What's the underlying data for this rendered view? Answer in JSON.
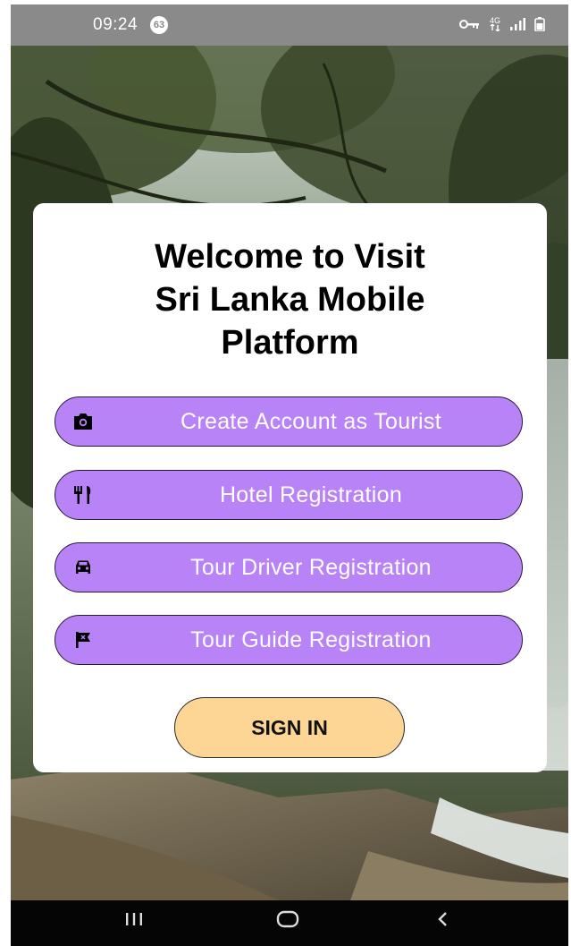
{
  "status_bar": {
    "time": "09:24",
    "notification_count": "63",
    "network_label": "4G",
    "icons": [
      "vpn-key-icon",
      "network-4g-icon",
      "signal-icon",
      "battery-icon"
    ]
  },
  "welcome": {
    "title": "Welcome to Visit\nSri Lanka Mobile\nPlatform"
  },
  "buttons": [
    {
      "label": "Create Account as Tourist",
      "icon": "camera-icon"
    },
    {
      "label": "Hotel Registration",
      "icon": "restaurant-icon"
    },
    {
      "label": "Tour Driver Registration",
      "icon": "car-icon"
    },
    {
      "label": "Tour Guide Registration",
      "icon": "flag-icon"
    }
  ],
  "sign_in": {
    "label": "SIGN IN"
  },
  "nav_bar": {
    "icons": [
      "recent-apps-icon",
      "home-icon",
      "back-icon"
    ]
  },
  "colors": {
    "button_purple": "#b883f7",
    "sign_in_peach": "#fdd595",
    "status_bar_gray": "#8a8a8a",
    "nav_bar_black": "#050505"
  }
}
